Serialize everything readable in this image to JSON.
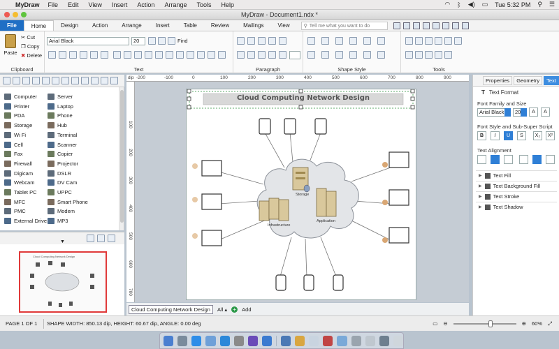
{
  "menubar": {
    "app_name": "MyDraw",
    "items": [
      "File",
      "Edit",
      "View",
      "Insert",
      "Action",
      "Arrange",
      "Tools",
      "Help"
    ],
    "clock": "Tue 5:32 PM"
  },
  "window": {
    "title": "MyDraw - Document1.ndx *"
  },
  "ribbon_tabs": {
    "file": "File",
    "items": [
      "Home",
      "Design",
      "Action",
      "Arrange",
      "Insert",
      "Table",
      "Review",
      "Mailings",
      "View"
    ],
    "tell_me_placeholder": "Tell me what you want to do"
  },
  "ribbon": {
    "clipboard": {
      "label": "Clipboard",
      "paste": "Paste",
      "cut": "Cut",
      "copy": "Copy",
      "delete": "Delete"
    },
    "text": {
      "label": "Text",
      "font_family": "Arial Black",
      "font_size": "20",
      "find": "Find"
    },
    "paragraph": {
      "label": "Paragraph"
    },
    "shape_style": {
      "label": "Shape Style"
    },
    "tools": {
      "label": "Tools"
    }
  },
  "stencils": {
    "col1": [
      "Computer",
      "Printer",
      "PDA",
      "Storage",
      "Wi Fi",
      "Cell",
      "Fax",
      "Firewall",
      "Digicam",
      "Webcam",
      "Tablet PC",
      "MFC",
      "PMC",
      "External Drive"
    ],
    "col2": [
      "Server",
      "Laptop",
      "Phone",
      "Hub",
      "Terminal",
      "Scanner",
      "Copier",
      "Projector",
      "DSLR",
      "DV Cam",
      "UPPC",
      "Smart Phone",
      "Modem",
      "MP3"
    ]
  },
  "thumbnail": {
    "title": "Cloud Computing Network Design"
  },
  "ruler": {
    "unit": "dip",
    "h_ticks": [
      "-200",
      "-100",
      "0",
      "100",
      "200",
      "300",
      "400",
      "500",
      "600",
      "700",
      "800",
      "900",
      "1000"
    ],
    "v_ticks": [
      "100",
      "200",
      "300",
      "400",
      "500",
      "600",
      "700"
    ]
  },
  "diagram": {
    "title": "Cloud Computing Network Design",
    "labels": {
      "storage": "Storage",
      "infrastructure": "Infrastructure",
      "application": "Application"
    }
  },
  "page_tabs": {
    "current": "Cloud Computing Network Design",
    "all": "All",
    "add": "Add"
  },
  "properties_panel": {
    "tabs": [
      "Properties",
      "Geometry",
      "Text"
    ],
    "active_tab": "Text",
    "header": "Text Format",
    "font_section": "Font Family and Size",
    "font_family": "Arial Black",
    "font_size": "20",
    "style_section": "Font Style and Sub-Super Script",
    "align_section": "Text Alignment",
    "style_buttons": [
      "B",
      "I",
      "U",
      "S",
      "X₂",
      "X²"
    ],
    "rows": [
      "Text Fill",
      "Text Background Fill",
      "Text Stroke",
      "Text Shadow"
    ]
  },
  "status": {
    "page": "PAGE 1 OF 1",
    "shape_info": "SHAPE WIDTH: 850.13 dip, HEIGHT: 60.67 dip, ANGLE: 0.00 deg",
    "zoom": "60%",
    "zoom_level": 0.6
  }
}
